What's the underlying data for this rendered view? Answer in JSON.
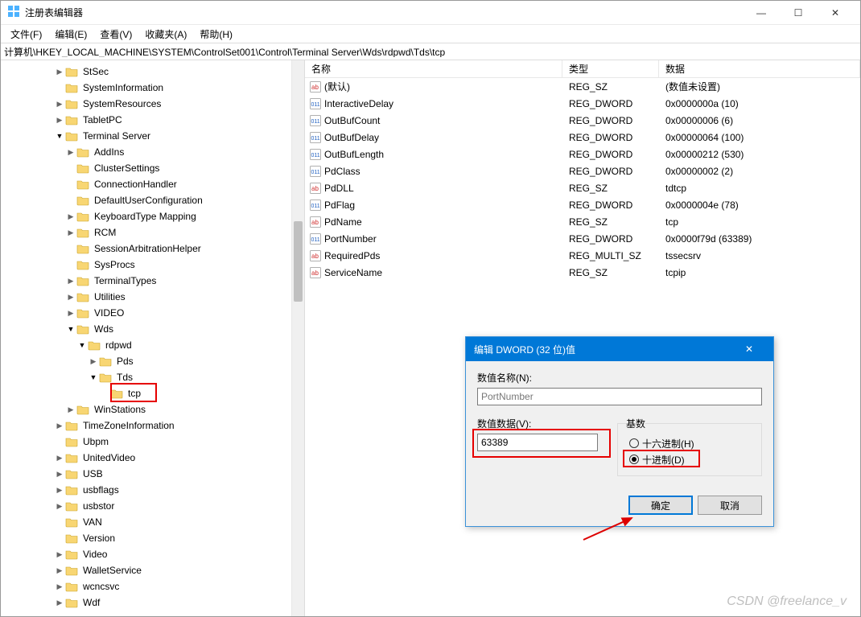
{
  "window": {
    "title": "注册表编辑器"
  },
  "menu": [
    "文件(F)",
    "编辑(E)",
    "查看(V)",
    "收藏夹(A)",
    "帮助(H)"
  ],
  "addressbar": "计算机\\HKEY_LOCAL_MACHINE\\SYSTEM\\ControlSet001\\Control\\Terminal Server\\Wds\\rdpwd\\Tds\\tcp",
  "tree": [
    {
      "lbl": "StSec",
      "ind": 0,
      "tw": ">"
    },
    {
      "lbl": "SystemInformation",
      "ind": 0,
      "tw": ""
    },
    {
      "lbl": "SystemResources",
      "ind": 0,
      "tw": ">"
    },
    {
      "lbl": "TabletPC",
      "ind": 0,
      "tw": ">"
    },
    {
      "lbl": "Terminal Server",
      "ind": 0,
      "tw": "v"
    },
    {
      "lbl": "AddIns",
      "ind": 1,
      "tw": ">"
    },
    {
      "lbl": "ClusterSettings",
      "ind": 1,
      "tw": ""
    },
    {
      "lbl": "ConnectionHandler",
      "ind": 1,
      "tw": ""
    },
    {
      "lbl": "DefaultUserConfiguration",
      "ind": 1,
      "tw": ""
    },
    {
      "lbl": "KeyboardType Mapping",
      "ind": 1,
      "tw": ">"
    },
    {
      "lbl": "RCM",
      "ind": 1,
      "tw": ">"
    },
    {
      "lbl": "SessionArbitrationHelper",
      "ind": 1,
      "tw": ""
    },
    {
      "lbl": "SysProcs",
      "ind": 1,
      "tw": ""
    },
    {
      "lbl": "TerminalTypes",
      "ind": 1,
      "tw": ">"
    },
    {
      "lbl": "Utilities",
      "ind": 1,
      "tw": ">"
    },
    {
      "lbl": "VIDEO",
      "ind": 1,
      "tw": ">"
    },
    {
      "lbl": "Wds",
      "ind": 1,
      "tw": "v"
    },
    {
      "lbl": "rdpwd",
      "ind": 2,
      "tw": "v"
    },
    {
      "lbl": "Pds",
      "ind": 3,
      "tw": ">"
    },
    {
      "lbl": "Tds",
      "ind": 3,
      "tw": "v"
    },
    {
      "lbl": "tcp",
      "ind": 4,
      "tw": "",
      "hl": true
    },
    {
      "lbl": "WinStations",
      "ind": 1,
      "tw": ">"
    },
    {
      "lbl": "TimeZoneInformation",
      "ind": 0,
      "tw": ">"
    },
    {
      "lbl": "Ubpm",
      "ind": 0,
      "tw": ""
    },
    {
      "lbl": "UnitedVideo",
      "ind": 0,
      "tw": ">"
    },
    {
      "lbl": "USB",
      "ind": 0,
      "tw": ">"
    },
    {
      "lbl": "usbflags",
      "ind": 0,
      "tw": ">"
    },
    {
      "lbl": "usbstor",
      "ind": 0,
      "tw": ">"
    },
    {
      "lbl": "VAN",
      "ind": 0,
      "tw": ""
    },
    {
      "lbl": "Version",
      "ind": 0,
      "tw": ""
    },
    {
      "lbl": "Video",
      "ind": 0,
      "tw": ">"
    },
    {
      "lbl": "WalletService",
      "ind": 0,
      "tw": ">"
    },
    {
      "lbl": "wcncsvc",
      "ind": 0,
      "tw": ">"
    },
    {
      "lbl": "Wdf",
      "ind": 0,
      "tw": ">"
    }
  ],
  "cols": {
    "name": "名称",
    "type": "类型",
    "data": "数据"
  },
  "values": [
    {
      "icon": "sz",
      "name": "(默认)",
      "type": "REG_SZ",
      "data": "(数值未设置)"
    },
    {
      "icon": "dw",
      "name": "InteractiveDelay",
      "type": "REG_DWORD",
      "data": "0x0000000a (10)"
    },
    {
      "icon": "dw",
      "name": "OutBufCount",
      "type": "REG_DWORD",
      "data": "0x00000006 (6)"
    },
    {
      "icon": "dw",
      "name": "OutBufDelay",
      "type": "REG_DWORD",
      "data": "0x00000064 (100)"
    },
    {
      "icon": "dw",
      "name": "OutBufLength",
      "type": "REG_DWORD",
      "data": "0x00000212 (530)"
    },
    {
      "icon": "dw",
      "name": "PdClass",
      "type": "REG_DWORD",
      "data": "0x00000002 (2)"
    },
    {
      "icon": "sz",
      "name": "PdDLL",
      "type": "REG_SZ",
      "data": "tdtcp"
    },
    {
      "icon": "dw",
      "name": "PdFlag",
      "type": "REG_DWORD",
      "data": "0x0000004e (78)"
    },
    {
      "icon": "sz",
      "name": "PdName",
      "type": "REG_SZ",
      "data": "tcp"
    },
    {
      "icon": "dw",
      "name": "PortNumber",
      "type": "REG_DWORD",
      "data": "0x0000f79d (63389)"
    },
    {
      "icon": "sz",
      "name": "RequiredPds",
      "type": "REG_MULTI_SZ",
      "data": "tssecsrv"
    },
    {
      "icon": "sz",
      "name": "ServiceName",
      "type": "REG_SZ",
      "data": "tcpip"
    }
  ],
  "dialog": {
    "title": "编辑 DWORD (32 位)值",
    "name_label": "数值名称(N):",
    "name_value": "PortNumber",
    "data_label": "数值数据(V):",
    "data_value": "63389",
    "base_label": "基数",
    "hex_label": "十六进制(H)",
    "dec_label": "十进制(D)",
    "ok": "确定",
    "cancel": "取消"
  },
  "watermark": "CSDN @freelance_v"
}
